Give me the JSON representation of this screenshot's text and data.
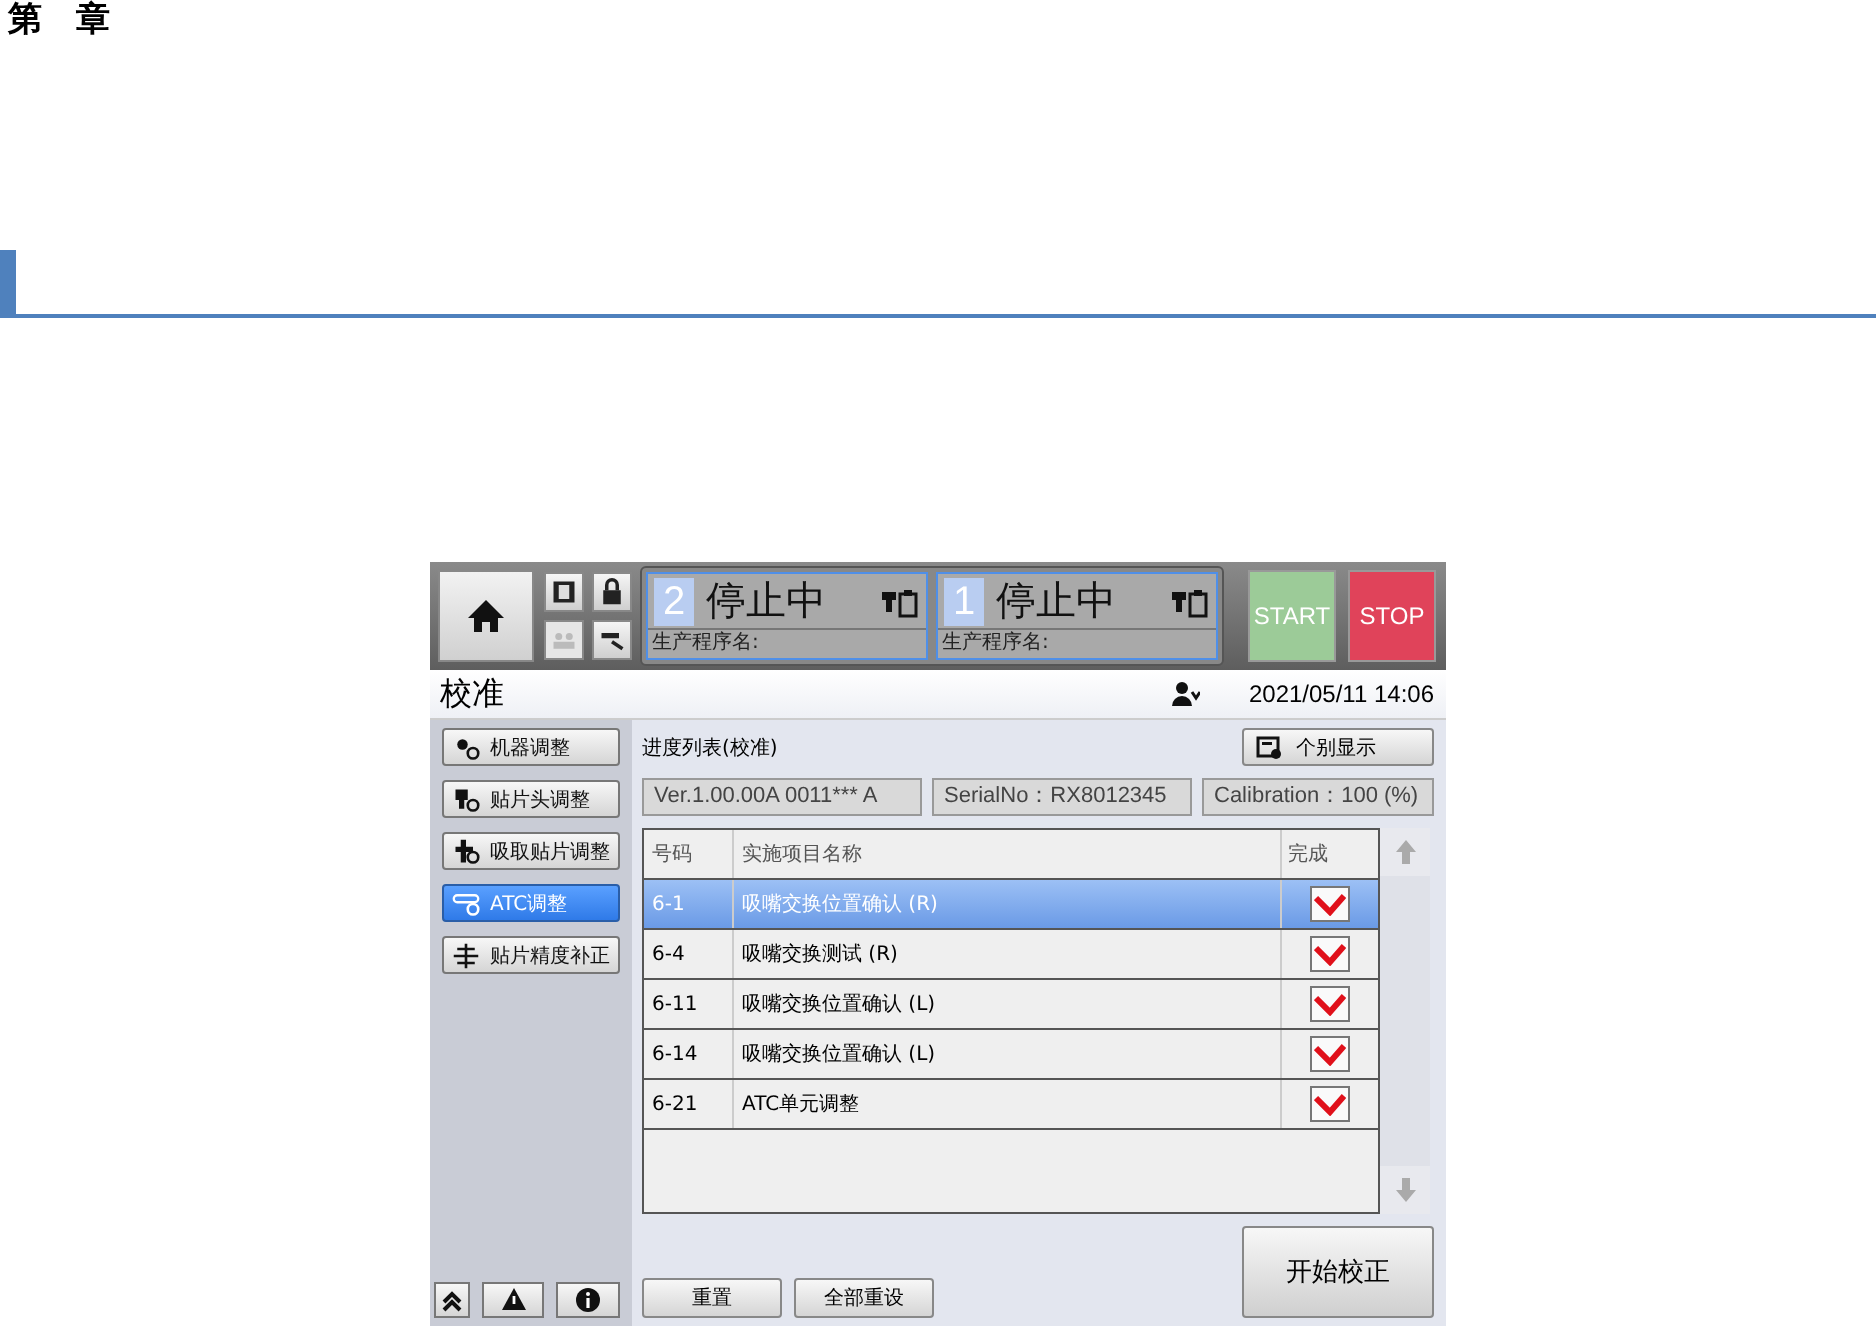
{
  "chapter_heading": "第　章",
  "topbar": {
    "panels": [
      {
        "number": "2",
        "status": "停止中",
        "program_label": "生产程序名:"
      },
      {
        "number": "1",
        "status": "停止中",
        "program_label": "生产程序名:"
      }
    ],
    "start": "START",
    "stop": "STOP"
  },
  "title_bar": {
    "title": "校准",
    "datetime": "2021/05/11 14:06"
  },
  "sidebar": {
    "items": [
      {
        "label": "机器调整",
        "selected": false
      },
      {
        "label": "贴片头调整",
        "selected": false
      },
      {
        "label": "吸取贴片调整",
        "selected": false
      },
      {
        "label": "ATC调整",
        "selected": true
      },
      {
        "label": "贴片精度补正",
        "selected": false
      }
    ]
  },
  "main": {
    "heading": "进度列表(校准)",
    "detail_button": "个别显示",
    "info_fields": [
      "Ver.1.00.00A 0011*** A",
      "SerialNo：RX8012345",
      "Calibration：100 (%)"
    ],
    "table": {
      "columns": [
        "号码",
        "实施项目名称",
        "完成"
      ],
      "rows": [
        {
          "number": "6-1",
          "name": "吸嘴交换位置确认 (R)",
          "done": true,
          "selected": true
        },
        {
          "number": "6-4",
          "name": "吸嘴交换测试 (R)",
          "done": true,
          "selected": false
        },
        {
          "number": "6-11",
          "name": "吸嘴交换位置确认 (L)",
          "done": true,
          "selected": false
        },
        {
          "number": "6-14",
          "name": "吸嘴交换位置确认 (L)",
          "done": true,
          "selected": false
        },
        {
          "number": "6-21",
          "name": "ATC单元调整",
          "done": true,
          "selected": false
        }
      ]
    },
    "buttons": [
      "重置",
      "全部重设"
    ],
    "start_button": "开始校正"
  }
}
